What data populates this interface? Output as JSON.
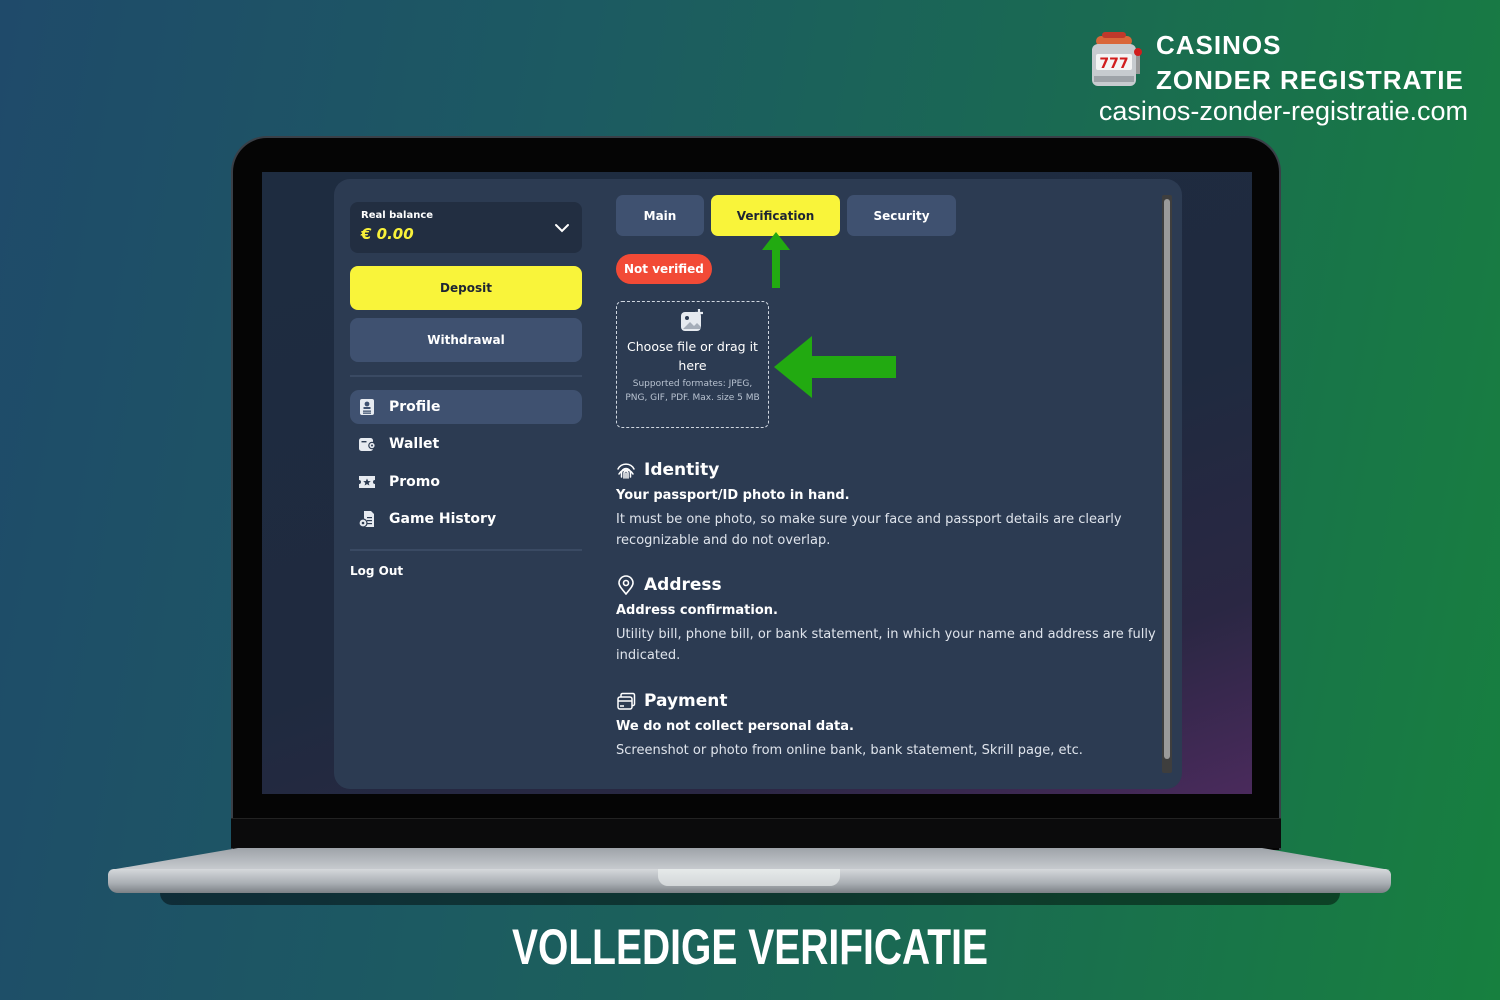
{
  "brand": {
    "line1": "CASINOS",
    "line2": "ZONDER REGISTRATIE",
    "url": "casinos-zonder-registratie.com",
    "logo_icon": "slot-machine-icon"
  },
  "sidebar": {
    "balance_label": "Real balance",
    "balance_value": "€ 0.00",
    "deposit_label": "Deposit",
    "withdraw_label": "Withdrawal",
    "items": [
      {
        "label": "Profile",
        "icon": "profile-icon",
        "active": true
      },
      {
        "label": "Wallet",
        "icon": "wallet-icon",
        "active": false
      },
      {
        "label": "Promo",
        "icon": "promo-ticket-icon",
        "active": false
      },
      {
        "label": "Game History",
        "icon": "game-history-icon",
        "active": false
      }
    ],
    "logout_label": "Log Out"
  },
  "tabs": [
    {
      "label": "Main",
      "active": false
    },
    {
      "label": "Verification",
      "active": true
    },
    {
      "label": "Security",
      "active": false
    }
  ],
  "status_badge": "Not verified",
  "upload": {
    "title": "Choose file or drag it here",
    "hint": "Supported formates: JPEG, PNG, GIF, PDF. Max. size 5 MB"
  },
  "sections": [
    {
      "icon": "fingerprint-icon",
      "title": "Identity",
      "subtitle": "Your passport/ID photo in hand.",
      "description": "It must be one photo, so make sure your face and passport details are clearly recognizable and do not overlap."
    },
    {
      "icon": "location-pin-icon",
      "title": "Address",
      "subtitle": "Address confirmation.",
      "description": "Utility bill, phone bill, or bank statement, in which your name and address are fully indicated."
    },
    {
      "icon": "credit-card-icon",
      "title": "Payment",
      "subtitle": "We do not collect personal data.",
      "description": "Screenshot or photo from online bank, bank statement, Skrill page, etc."
    }
  ],
  "colors": {
    "accent_yellow": "#f9f43a",
    "badge_red": "#f24a36",
    "annotation_green": "#22aa11",
    "panel_bg": "#2c3b52"
  },
  "caption": "VOLLEDIGE VERIFICATIE"
}
